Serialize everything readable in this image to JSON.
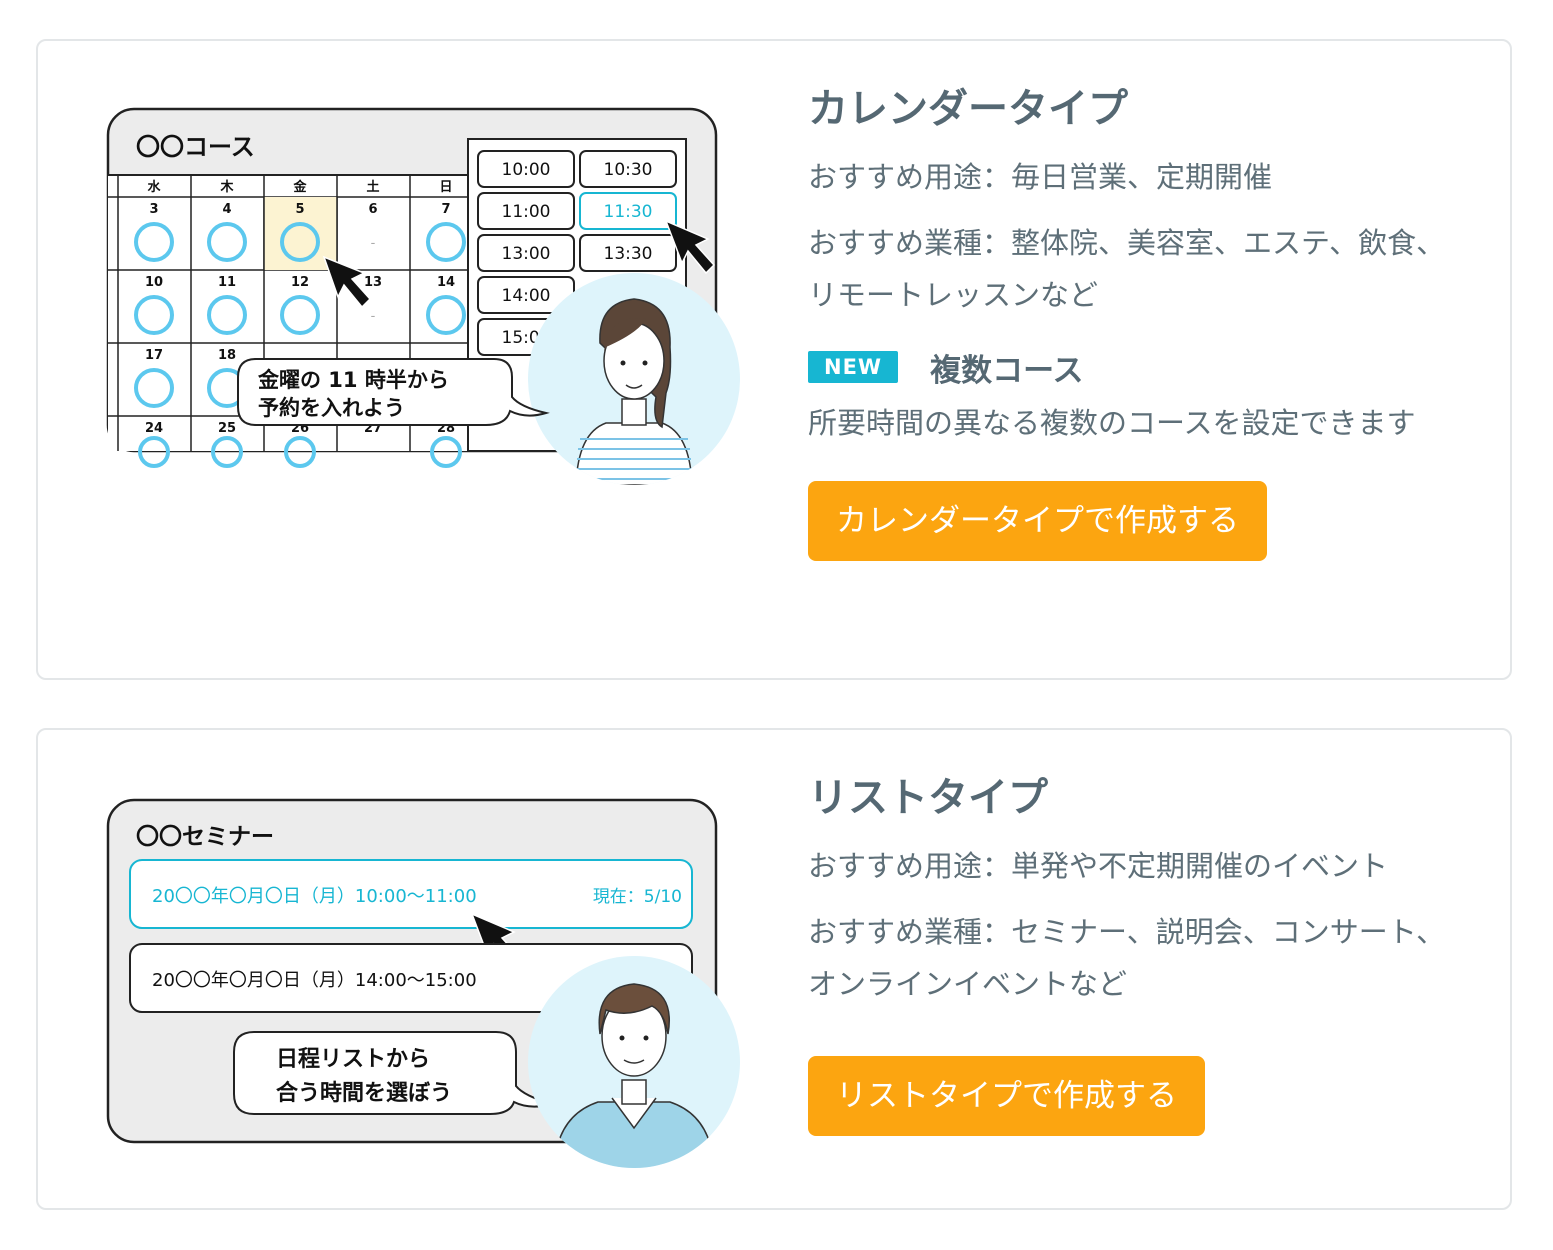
{
  "calendar_card": {
    "title": "カレンダータイプ",
    "use_case": "おすすめ用途：毎日営業、定期開催",
    "industry": "おすすめ業種：整体院、美容室、エステ、飲食、リモートレッスンなど",
    "badge": "NEW",
    "feature_title": "複数コース",
    "feature_desc": "所要時間の異なる複数のコースを設定できます",
    "button_label": "カレンダータイプで作成する",
    "illustration": {
      "course_title": "〇〇コース",
      "weekdays": [
        "水",
        "木",
        "金",
        "土",
        "日"
      ],
      "dates_row1": [
        "3",
        "4",
        "5",
        "6",
        "7"
      ],
      "dates_row2": [
        "10",
        "11",
        "12",
        "13",
        "14"
      ],
      "dates_row3": [
        "17",
        "18"
      ],
      "dates_row4": [
        "24",
        "25",
        "26",
        "27",
        "28"
      ],
      "dash": "-",
      "times": [
        "10:00",
        "10:30",
        "11:00",
        "11:30",
        "13:00",
        "13:30",
        "14:00",
        "15:00"
      ],
      "speech_line1": "金曜の 11 時半から",
      "speech_line2": "予約を入れよう"
    }
  },
  "list_card": {
    "title": "リストタイプ",
    "use_case": "おすすめ用途：単発や不定期開催のイベント",
    "industry": "おすすめ業種：セミナー、説明会、コンサート、オンラインイベントなど",
    "button_label": "リストタイプで作成する",
    "illustration": {
      "seminar_title": "〇〇セミナー",
      "slot1": "20〇〇年〇月〇日（月）10:00〜11:00",
      "slot1_status": "現在：5/10",
      "slot2": "20〇〇年〇月〇日（月）14:00〜15:00",
      "speech_line1": "日程リストから",
      "speech_line2": "合う時間を選ぼう"
    }
  },
  "colors": {
    "accent_button": "#fca510",
    "badge": "#17b6d2",
    "circle": "#5cc8ee",
    "highlight": "#17b6d2"
  }
}
